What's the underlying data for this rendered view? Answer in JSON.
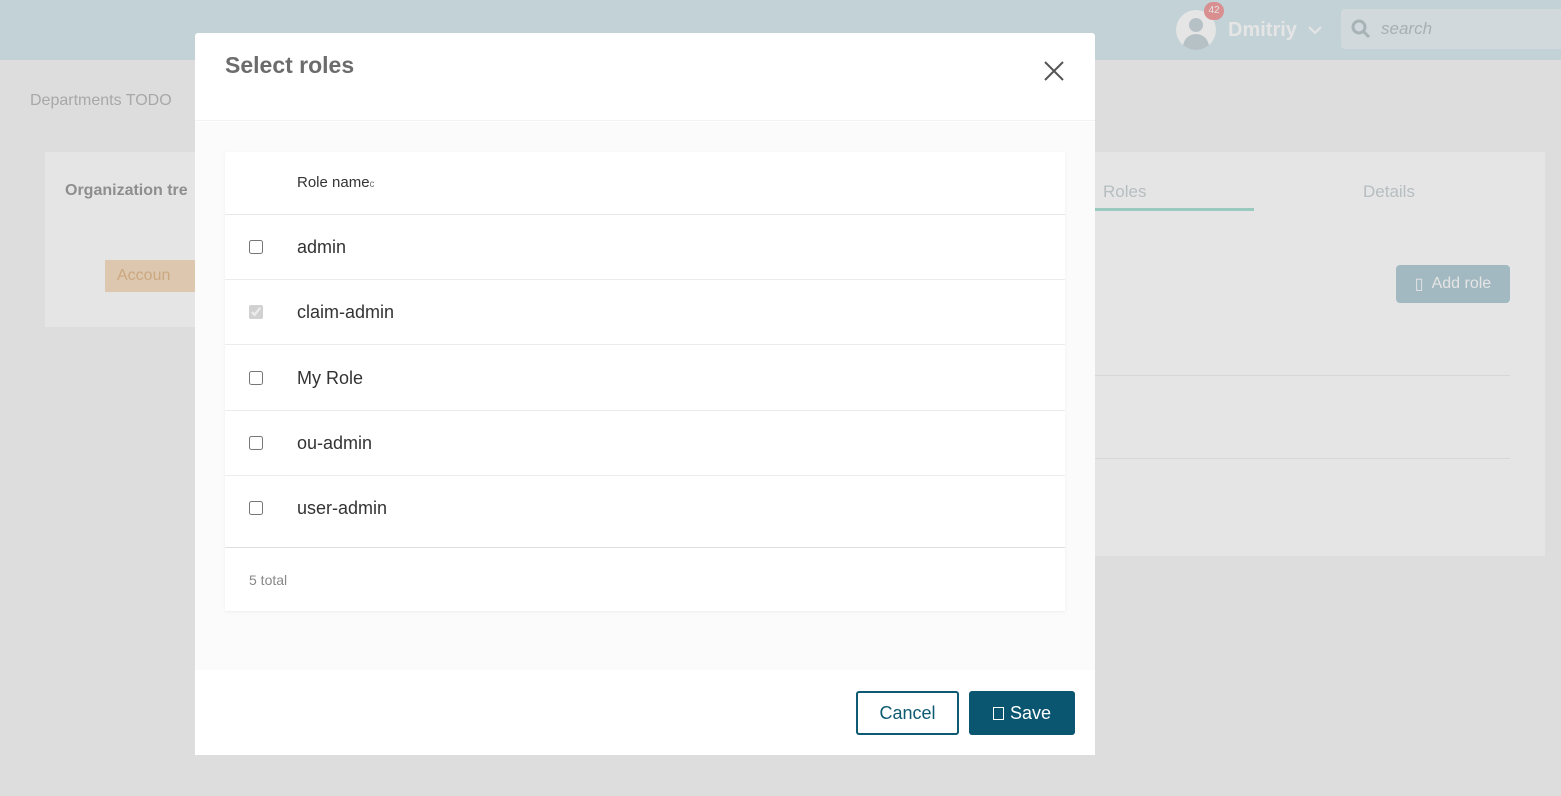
{
  "header": {
    "user_name": "Dmitriy",
    "notification_count": "42",
    "search_placeholder": "search"
  },
  "page": {
    "breadcrumb": "Departments TODO",
    "left_card_title": "Organization tre",
    "account_tag": "Accoun",
    "tabs": [
      {
        "label": "Roles"
      },
      {
        "label": "Details"
      }
    ],
    "add_role_label": "Add role"
  },
  "modal": {
    "title": "Select roles",
    "column_header": "Role name",
    "sort_icon": "c",
    "rows": [
      {
        "name": "admin",
        "checked": false
      },
      {
        "name": "claim-admin",
        "checked": true
      },
      {
        "name": "My Role",
        "checked": false
      },
      {
        "name": "ou-admin",
        "checked": false
      },
      {
        "name": "user-admin",
        "checked": false
      }
    ],
    "total": "5 total",
    "cancel_label": "Cancel",
    "save_label": "Save"
  }
}
